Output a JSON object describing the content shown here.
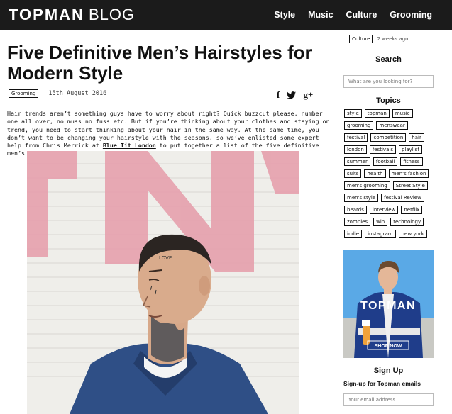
{
  "header": {
    "brand": "TOPMAN",
    "blog": "BLOG",
    "nav": [
      "Style",
      "Music",
      "Culture",
      "Grooming"
    ]
  },
  "article": {
    "title": "Five Definitive Men’s Hairstyles for Modern Style",
    "category": "Grooming",
    "date": "15th August 2016",
    "share": {
      "facebook": "f",
      "twitter": "🐦",
      "google": "g+"
    },
    "intro_before_link": "Hair trends aren’t something guys have to worry about right? Quick buzzcut please, number one all over, no muss no fuss etc. But if you’re thinking about your clothes and staying on trend, you need to start thinking about your hair in the same way. At the same time, you don’t want to be changing your hairstyle with the seasons, so we’ve enlisted some expert help from Chris Merrick at ",
    "intro_link": "Blue Tit London",
    "intro_after_link": " to put together a list of the five definitive men’s hairstyles.",
    "photo_text": "LOVE"
  },
  "sidebar": {
    "recent_tag": "Culture",
    "recent_ago": "2 weeks ago",
    "search_heading": "Search",
    "search_placeholder": "What are you looking for?",
    "topics_heading": "Topics",
    "topics": [
      "style",
      "topman",
      "music",
      "grooming",
      "menswear",
      "festival",
      "competition",
      "hair",
      "london",
      "festivals",
      "playlist",
      "summer",
      "football",
      "fitness",
      "suits",
      "health",
      "men's fashion",
      "men's grooming",
      "Street Style",
      "men's style",
      "festival Review",
      "beards",
      "interview",
      "netflix",
      "zombies",
      "win",
      "technology",
      "indie",
      "instagram",
      "new york"
    ],
    "ad": {
      "brand": "TOPMAN",
      "cta": "SHOP NOW"
    },
    "signup_heading": "Sign Up",
    "signup_sub": "Sign-up for Topman emails",
    "email_placeholder": "Your email address"
  },
  "colors": {
    "topbar": "#1b1b1b",
    "ad_sky": "#5aa9e6",
    "wall_pink": "#e6a0ad"
  }
}
